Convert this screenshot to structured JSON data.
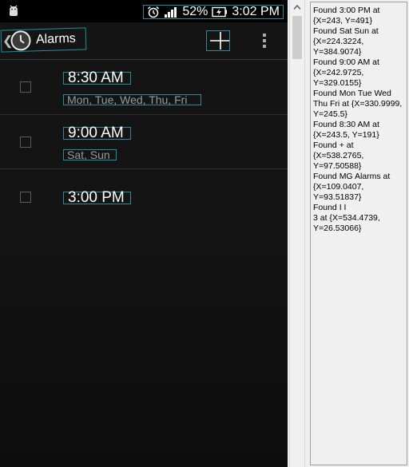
{
  "statusbar": {
    "battery": "52%",
    "clock": "3:02 PM",
    "icons": [
      "android-icon",
      "alarm-clock-icon",
      "signal-icon",
      "battery-charging-icon"
    ]
  },
  "actionbar": {
    "back": "❮",
    "title": "Alarms",
    "icons": [
      "clock-icon",
      "add-icon",
      "overflow-icon"
    ]
  },
  "alarms": [
    {
      "time": "8:30 AM",
      "days": "Mon, Tue, Wed, Thu, Fri"
    },
    {
      "time": "9:00 AM",
      "days": "Sat, Sun"
    },
    {
      "time": "3:00 PM",
      "days": ""
    }
  ],
  "log": [
    "Found 3:00 PM at\n{X=243, Y=491}",
    "Found Sat Sun at\n{X=224.3224,\nY=384.9074}",
    "Found 9:00 AM at\n{X=242.9725,\nY=329.0155}",
    "Found Mon Tue Wed\nThu Fri at {X=330.9999,\nY=245.5}",
    "Found 8:30 AM at\n{X=243.5, Y=191}",
    "Found + at\n{X=538.2765,\nY=97.50588}",
    "Found MG Alarms at\n{X=109.0407,\nY=93.51837}",
    "Found I I\n3 at {X=534.4739,\nY=26.53066}"
  ],
  "colors": {
    "highlight": "#1e8f9a",
    "background": "#141414",
    "text": "#ffffff",
    "subtext": "#9a9a9a"
  }
}
